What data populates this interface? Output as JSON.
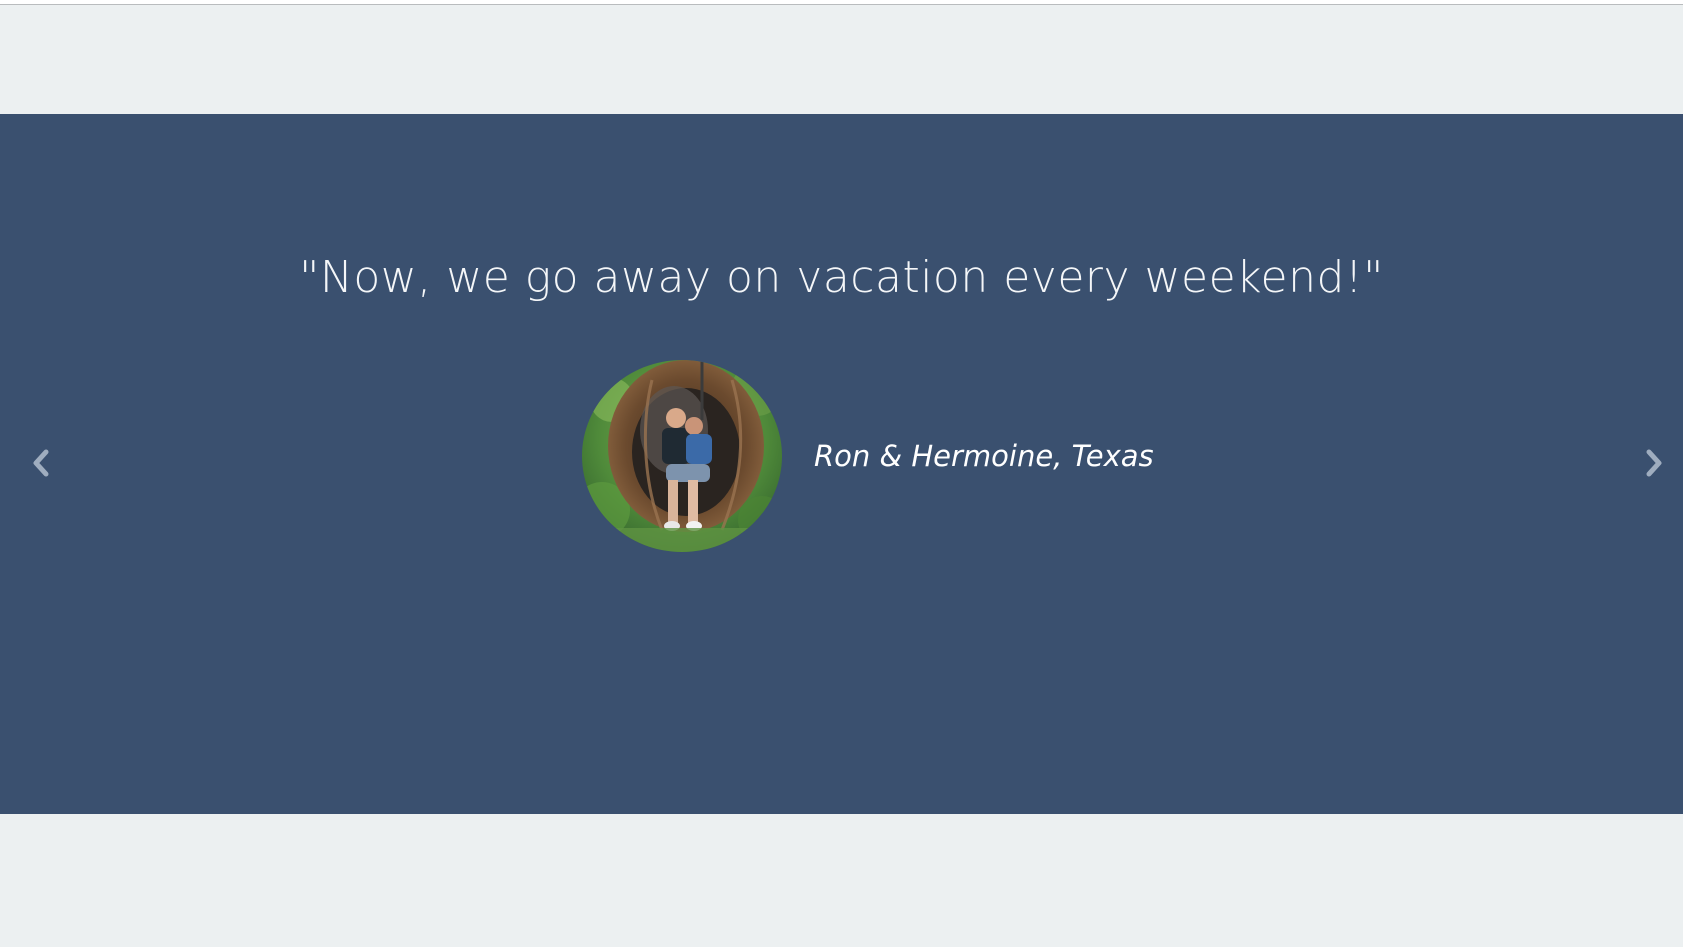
{
  "testimonial": {
    "quote": "\"Now, we go away on vacation every weekend!\"",
    "author": "Ron & Hermoine, Texas"
  },
  "carousel": {
    "prev_icon": "chevron-left-icon",
    "next_icon": "chevron-right-icon"
  },
  "colors": {
    "page_background": "#ecf0f1",
    "carousel_background": "#3a506f",
    "text": "#f4f6f8",
    "arrow": "#9fadbf"
  }
}
